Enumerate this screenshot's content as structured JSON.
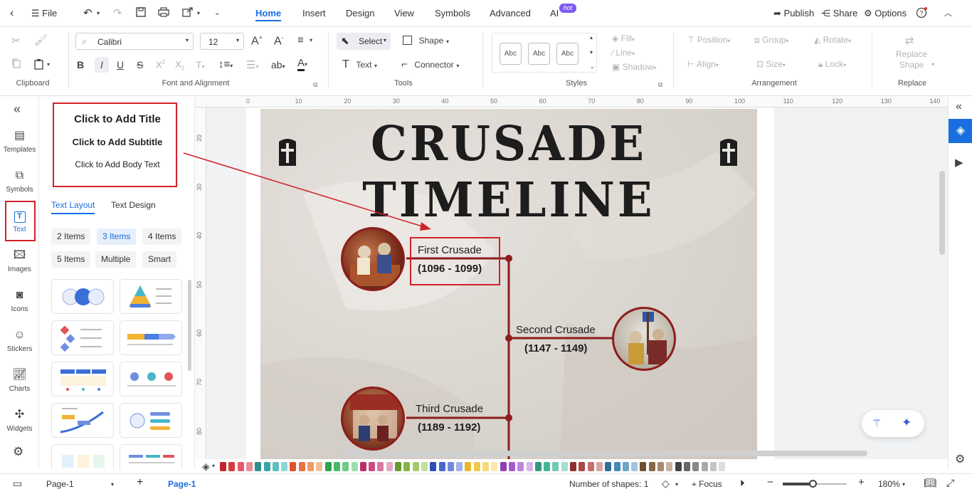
{
  "menubar": {
    "file": "File",
    "tabs": [
      "Home",
      "Insert",
      "Design",
      "View",
      "Symbols",
      "Advanced",
      "AI"
    ],
    "hot_badge": "hot",
    "publish": "Publish",
    "share": "Share",
    "options": "Options"
  },
  "ribbon": {
    "font_name": "Calibri",
    "font_size": "12",
    "select": "Select",
    "shape": "Shape",
    "text": "Text",
    "connector": "Connector",
    "style_sample": "Abc",
    "fill": "Fill",
    "line": "Line",
    "shadow": "Shadow",
    "position": "Position",
    "group": "Group",
    "rotate": "Rotate",
    "align": "Align",
    "size": "Size",
    "lock": "Lock",
    "replace_shape_1": "Replace",
    "replace_shape_2": "Shape",
    "groups": {
      "clipboard": "Clipboard",
      "font_alignment": "Font and Alignment",
      "tools": "Tools",
      "styles": "Styles",
      "arrangement": "Arrangement",
      "replace": "Replace"
    }
  },
  "leftbar": {
    "items": [
      "Templates",
      "Symbols",
      "Text",
      "Images",
      "Icons",
      "Stickers",
      "Charts",
      "Widgets"
    ]
  },
  "text_panel": {
    "title": "Click to Add Title",
    "subtitle": "Click to Add Subtitle",
    "body": "Click to Add Body Text",
    "tabs": [
      "Text Layout",
      "Text Design"
    ],
    "chips": [
      "2 Items",
      "3 Items",
      "4 Items",
      "5 Items",
      "Multiple",
      "Smart"
    ]
  },
  "ruler": {
    "h": [
      "0",
      "10",
      "20",
      "30",
      "40",
      "50",
      "60",
      "70",
      "80",
      "90",
      "100",
      "110",
      "120",
      "130",
      "140"
    ],
    "v": [
      "20",
      "30",
      "40",
      "50",
      "60",
      "70",
      "80"
    ]
  },
  "document": {
    "title": "CRUSADE TIMELINE",
    "events": [
      {
        "name": "First Crusade",
        "years": "(1096 - 1099)"
      },
      {
        "name": "Second Crusade",
        "years": "(1147 - 1149)"
      },
      {
        "name": "Third Crusade",
        "years": "(1189 - 1192)"
      }
    ]
  },
  "statusbar": {
    "page_select": "Page-1",
    "page_tab": "Page-1",
    "shapes": "Number of shapes: 1",
    "focus": "Focus",
    "zoom": "180%"
  },
  "colors": {
    "accent": "#1a6fe0",
    "highlight_red": "#d0212a",
    "timeline_red": "#8d1d1d",
    "palette": [
      "#c1272d",
      "#d63a3f",
      "#e05c6a",
      "#e88c95",
      "#2f8f8f",
      "#3aa5a5",
      "#5cc0c0",
      "#8fd6d6",
      "#e0532a",
      "#e8743f",
      "#ee9b6a",
      "#f2bf9a",
      "#2fa34f",
      "#49b867",
      "#6fcb87",
      "#9fdfae",
      "#b82f68",
      "#cc4a82",
      "#d978a4",
      "#e6a8c6",
      "#6b9a2f",
      "#86b546",
      "#a4cb6b",
      "#c6e09f",
      "#2e4fb5",
      "#4a69cc",
      "#7288db",
      "#a3b2e9",
      "#e9b52a",
      "#f0c94a",
      "#f5d97a",
      "#f9e9ad",
      "#8e3fb5",
      "#a55ccc",
      "#be86dc",
      "#d8b4eb",
      "#2f9a7c",
      "#46b596",
      "#6fcab1",
      "#a2dfcd",
      "#8f2f2f",
      "#aa4646",
      "#c27070",
      "#daa3a3",
      "#2f6f9a",
      "#4687b5",
      "#70a5ca",
      "#a3c6df",
      "#6f4f2f",
      "#8a6846",
      "#a88a6f",
      "#c8b3a0",
      "#444444",
      "#666666",
      "#888888",
      "#aaaaaa",
      "#c5c5c5",
      "#dddddd"
    ]
  }
}
